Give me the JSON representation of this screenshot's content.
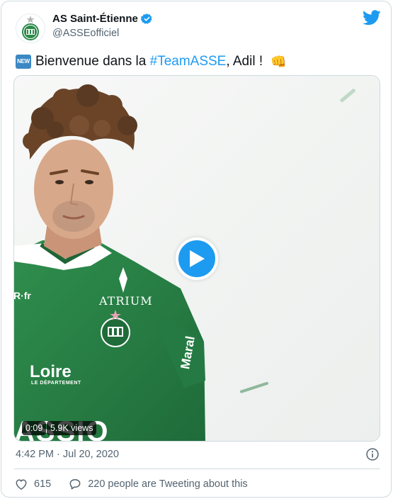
{
  "account": {
    "name": "AS Saint-Étienne",
    "handle": "@ASSEofficiel"
  },
  "tweet": {
    "badge": "NEW",
    "text_before": "Bienvenue dans la ",
    "hashtag": "#TeamASSE",
    "text_after": ", Adil ! ",
    "emoji": "👊"
  },
  "media": {
    "duration": "0:09",
    "views": "5.9K views",
    "jersey": {
      "sponsor_top": "ATRIUM",
      "sponsor_front": "Loire",
      "sponsor_front_sub": "LE DÉPARTEMENT",
      "sleeve_text": "Maral",
      "bottom_text": "ASSIO",
      "collar_text": "R·fr"
    }
  },
  "footer": {
    "timestamp": "4:42 PM · Jul 20, 2020",
    "likes": "615",
    "tweeting": "220 people are Tweeting about this"
  },
  "colors": {
    "accent": "#1d9bf0",
    "asse_green": "#2c8a4a",
    "muted": "#536471"
  }
}
